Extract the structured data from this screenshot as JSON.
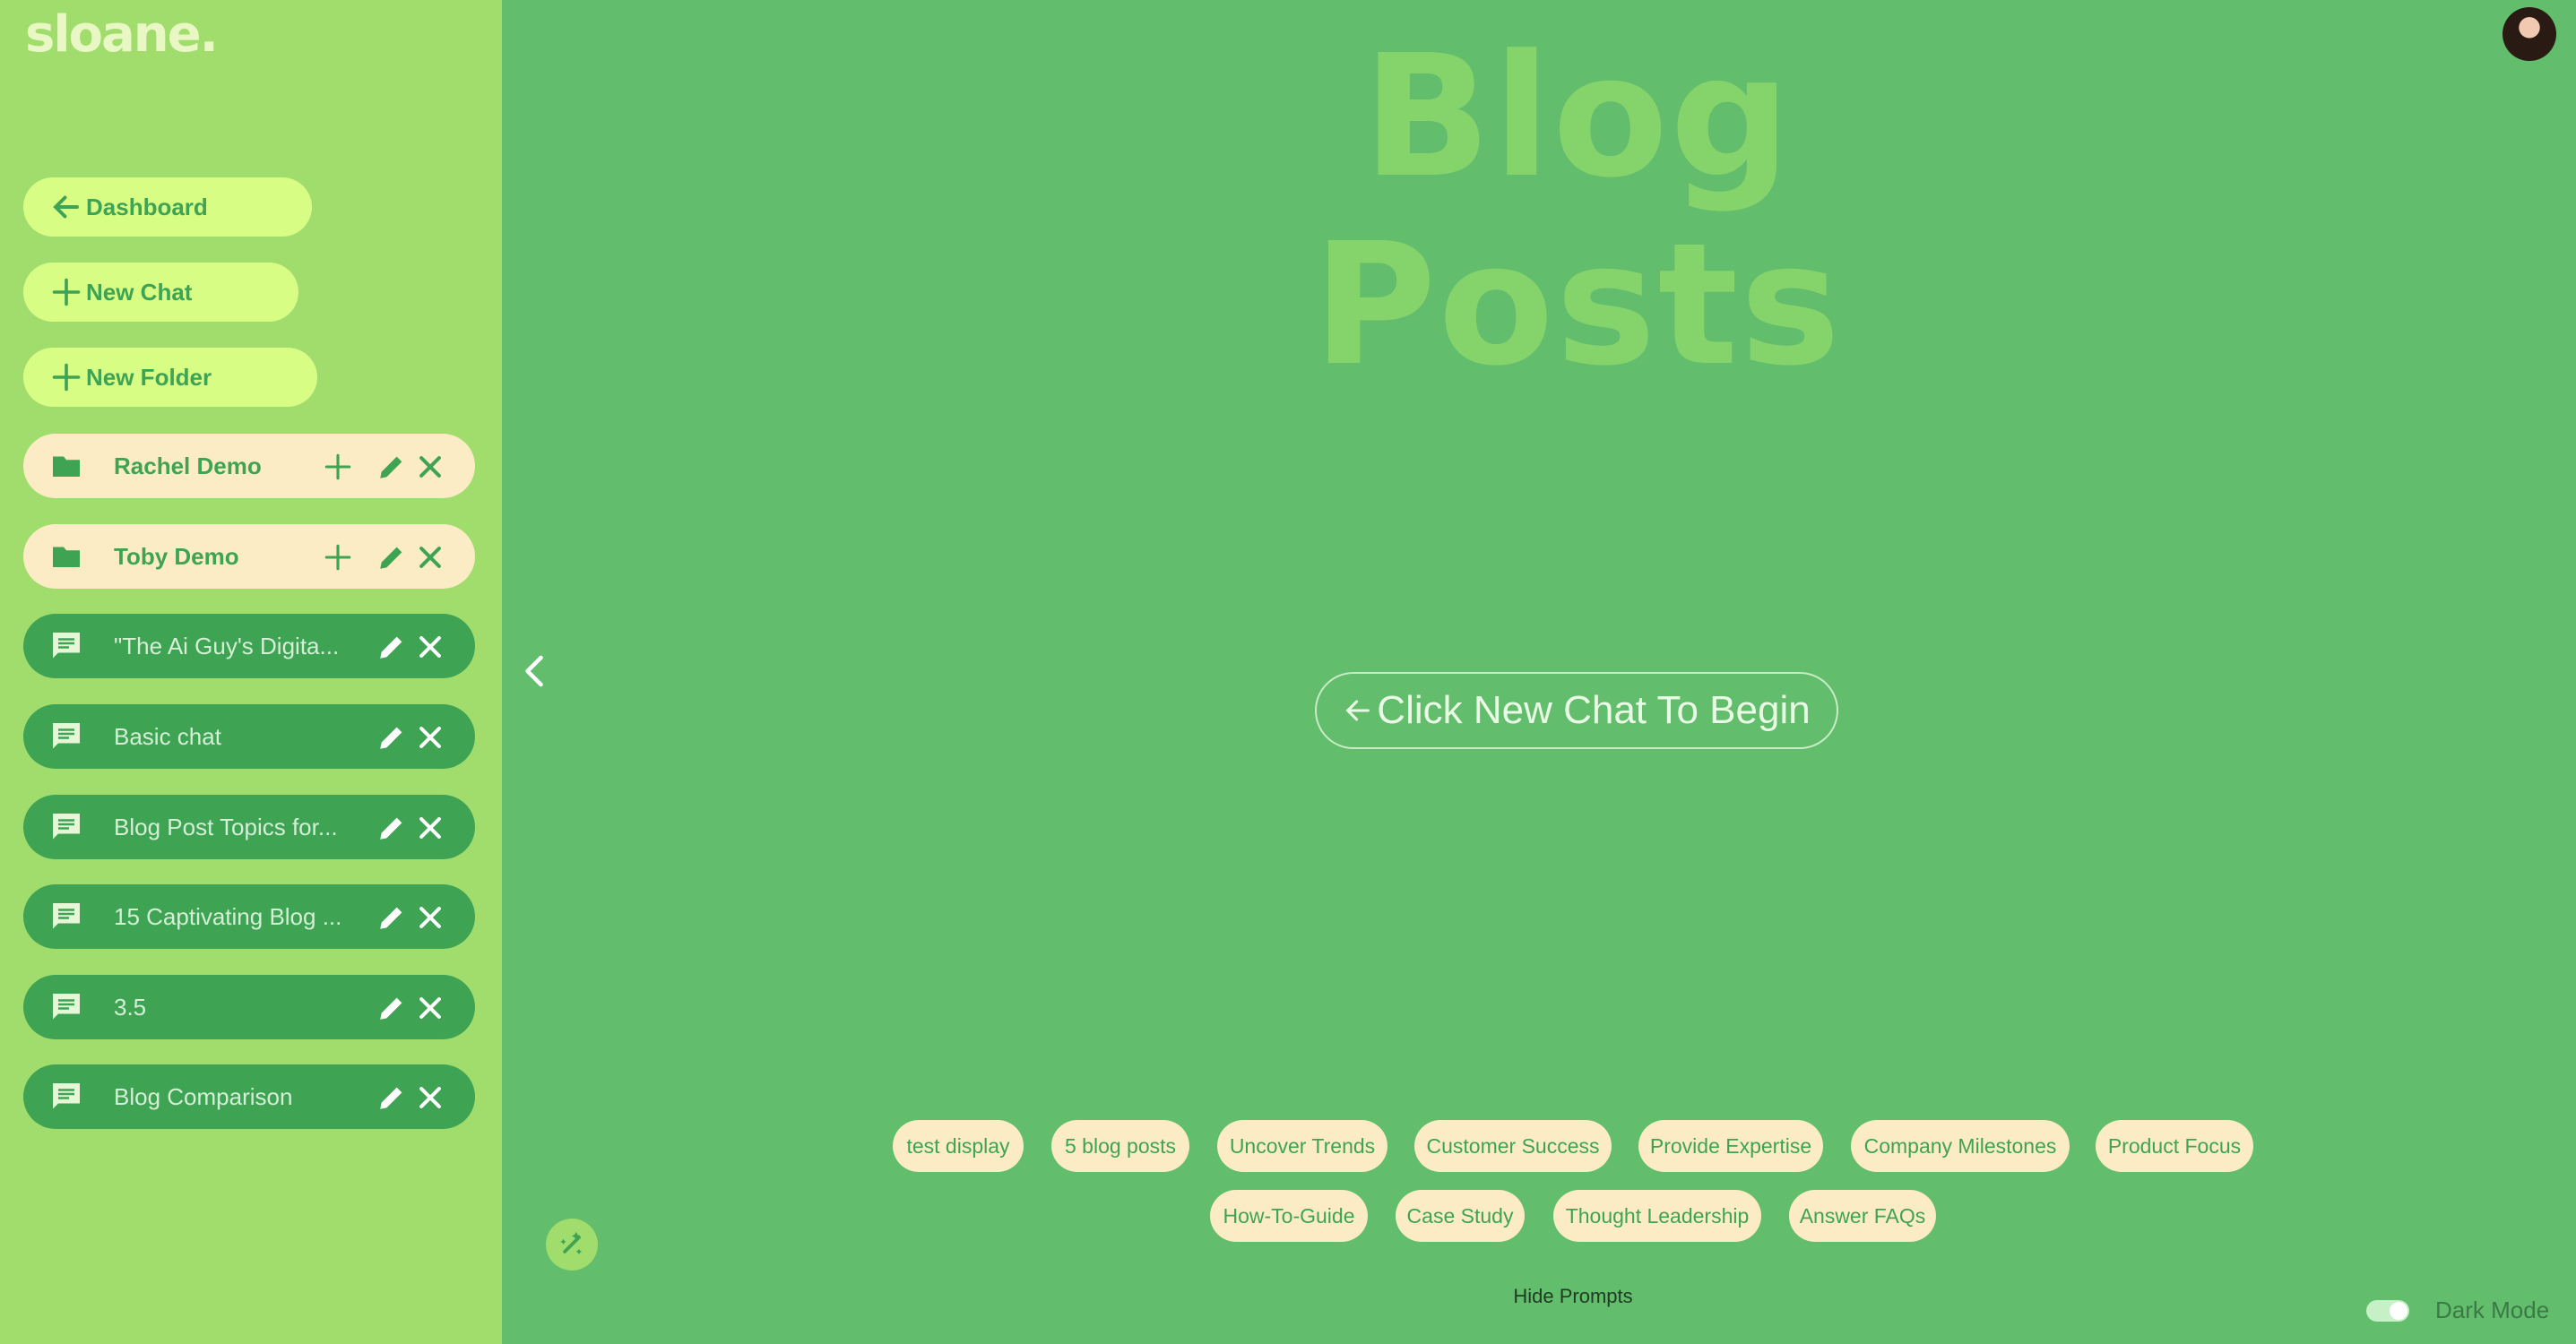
{
  "brand": {
    "logo": "sloane."
  },
  "nav": {
    "dashboard": "Dashboard",
    "new_chat": "New Chat",
    "new_folder": "New Folder"
  },
  "folders": [
    {
      "label": "Rachel Demo"
    },
    {
      "label": "Toby Demo"
    }
  ],
  "chats": [
    {
      "label": "\"The Ai Guy's Digita..."
    },
    {
      "label": "Basic chat"
    },
    {
      "label": "Blog Post Topics for..."
    },
    {
      "label": "15 Captivating Blog ..."
    },
    {
      "label": "3.5"
    },
    {
      "label": "Blog Comparison"
    }
  ],
  "main": {
    "title": "Blog Posts",
    "begin_label": "Click New Chat To Begin",
    "prompts_row1": [
      "test display",
      "5 blog posts",
      "Uncover Trends",
      "Customer Success",
      "Provide Expertise",
      "Company Milestones",
      "Product Focus"
    ],
    "prompts_row2": [
      "How-To-Guide",
      "Case Study",
      "Thought Leadership",
      "Answer FAQs"
    ],
    "hide_prompts": "Hide Prompts"
  },
  "footer": {
    "dark_mode_label": "Dark Mode"
  },
  "icons": {
    "back": "arrow-left-icon",
    "add": "plus-icon",
    "folder": "folder-icon",
    "chat": "chat-bubble-icon",
    "edit": "pencil-icon",
    "delete": "close-icon",
    "collapse": "chevron-left-icon",
    "magic": "magic-wand-icon"
  },
  "colors": {
    "main_bg": "#62bd6c",
    "sidebar_bg": "#a0dd6c",
    "nav_button": "#d8fd84",
    "folder_row": "#fbecc5",
    "chat_row": "#3fa354",
    "chip_bg": "#fbecc5"
  }
}
